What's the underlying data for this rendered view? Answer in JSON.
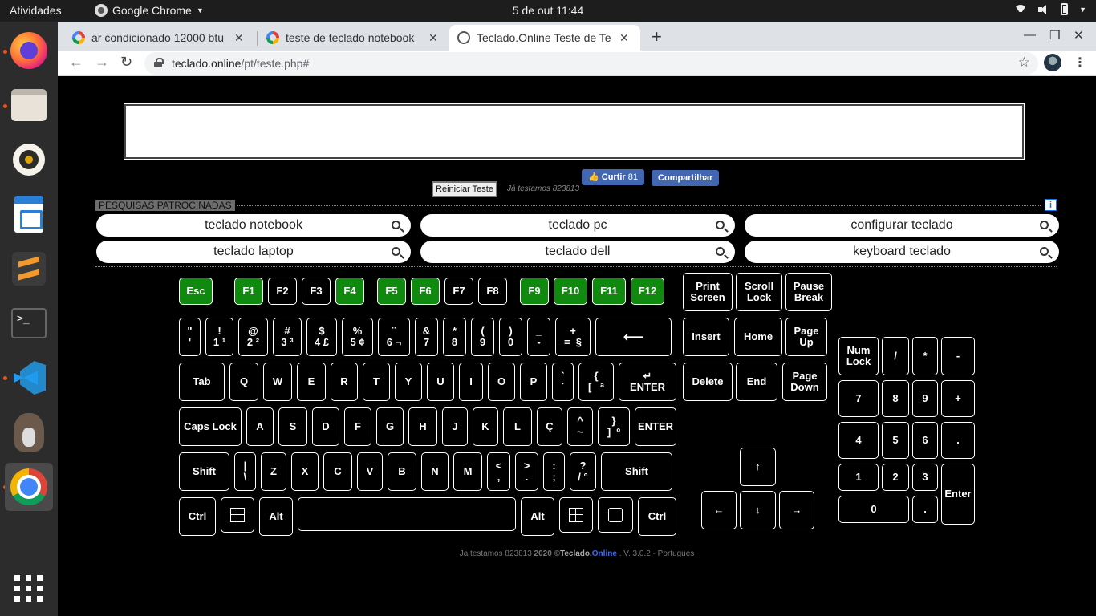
{
  "topbar": {
    "activities": "Atividades",
    "app_name": "Google Chrome",
    "clock": "5 de out  11:44"
  },
  "tabs": [
    {
      "label": "ar condicionado 12000 btu",
      "icon": "google-icon"
    },
    {
      "label": "teste de teclado notebook",
      "icon": "google-icon"
    },
    {
      "label": "Teclado.Online Teste de Te",
      "icon": "globe-icon"
    }
  ],
  "address": {
    "host": "teclado.online",
    "path": "/pt/teste.php#"
  },
  "page": {
    "reset_label": "Reiniciar Teste",
    "tested_label": "Já testamos 823813",
    "fb_like": "Curtir",
    "fb_like_count": "81",
    "fb_share": "Compartilhar",
    "sponsored_label": "PESQUISAS PATROCINADAS",
    "info_label": "i",
    "searches": [
      "teclado notebook",
      "teclado pc",
      "configurar teclado",
      "teclado laptop",
      "teclado dell",
      "keyboard teclado"
    ]
  },
  "keys": {
    "esc": "Esc",
    "f1": "F1",
    "f2": "F2",
    "f3": "F3",
    "f4": "F4",
    "f5": "F5",
    "f6": "F6",
    "f7": "F7",
    "f8": "F8",
    "f9": "F9",
    "f10": "F10",
    "f11": "F11",
    "f12": "F12",
    "print": "Print\nScreen",
    "scroll": "Scroll\nLock",
    "pause": "Pause\nBreak",
    "quote": "\"\n'",
    "k1": "!\n1 ¹",
    "k2": "@\n2 ²",
    "k3": "#\n3 ³",
    "k4": "$\n4 £",
    "k5": "%\n5 ¢",
    "k6": "¨\n6 ¬",
    "k7": "&\n7",
    "k8": "*\n8",
    "k9": "(\n9",
    "k0": ")\n0",
    "minus": "_\n-",
    "equal": "+\n=  §",
    "backspace": "⟵",
    "insert": "Insert",
    "home": "Home",
    "pgup": "Page\nUp",
    "tab": "Tab",
    "q": "Q",
    "w": "W",
    "e": "E",
    "r": "R",
    "t": "T",
    "y": "Y",
    "u": "U",
    "i": "I",
    "o": "O",
    "p": "P",
    "acute": "`\n´",
    "lbracket": "{\n[   ª",
    "enter1": "↵\nENTER",
    "delete": "Delete",
    "end": "End",
    "pgdn": "Page\nDown",
    "caps": "Caps Lock",
    "a": "A",
    "s": "S",
    "d": "D",
    "f": "F",
    "g": "G",
    "h": "H",
    "j": "J",
    "k": "K",
    "l": "L",
    "cced": "Ç",
    "tilde": "^\n~",
    "rbracket": "}\n]  º",
    "enter2": "ENTER",
    "lshift": "Shift",
    "pipe": "|\n\\",
    "z": "Z",
    "x": "X",
    "c": "C",
    "v": "V",
    "b": "B",
    "n": "N",
    "m": "M",
    "comma": "<\n,",
    "period": ">\n.",
    "semicolon": ":\n;",
    "slash": "?\n/ °",
    "rshift": "Shift",
    "lctrl": "Ctrl",
    "lalt": "Alt",
    "space": "",
    "ralt": "Alt",
    "rctrl": "Ctrl",
    "up": "↑",
    "left": "←",
    "down": "↓",
    "right": "→",
    "numlock": "Num\nLock",
    "ndiv": "/",
    "nmul": "*",
    "nsub": "-",
    "n7": "7",
    "n8": "8",
    "n9": "9",
    "nadd": "+",
    "n4": "4",
    "n5": "5",
    "n6": "6",
    "ndot2": ".",
    "n1": "1",
    "n2": "2",
    "n3": "3",
    "nenter": "Enter",
    "n0": "0",
    "ndot": "."
  },
  "footer": {
    "prefix": "Ja testamos 823813",
    "year": "2020",
    "copy": "©",
    "brand_a": "Teclado.",
    "brand_b": "Online",
    "suffix": ". V. 3.0.2 - Portugues"
  }
}
